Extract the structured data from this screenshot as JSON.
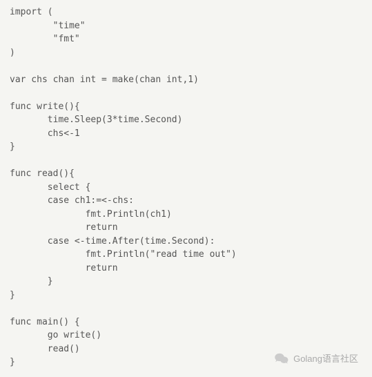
{
  "code": {
    "lines": [
      "import (",
      "        \"time\"",
      "        \"fmt\"",
      ")",
      "",
      "var chs chan int = make(chan int,1)",
      "",
      "func write(){",
      "       time.Sleep(3*time.Second)",
      "       chs<-1",
      "}",
      "",
      "func read(){",
      "       select {",
      "       case ch1:=<-chs:",
      "              fmt.Println(ch1)",
      "              return",
      "       case <-time.After(time.Second):",
      "              fmt.Println(\"read time out\")",
      "              return",
      "       }",
      "}",
      "",
      "func main() {",
      "       go write()",
      "       read()",
      "}"
    ]
  },
  "watermark": {
    "text": "Golang语言社区",
    "icon": "wechat-icon"
  }
}
